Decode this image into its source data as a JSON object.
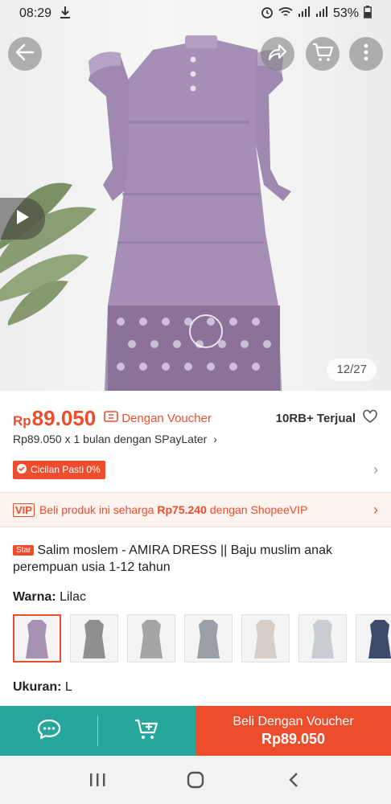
{
  "status_bar": {
    "time": "08:29",
    "battery": "53%",
    "icons": [
      "download-icon",
      "alarm-icon",
      "wifi-icon",
      "signal-icon",
      "signal-icon",
      "battery-icon"
    ]
  },
  "gallery": {
    "counter": "12/27",
    "buttons": [
      "back-arrow-icon",
      "share-icon",
      "cart-icon",
      "more-vertical-icon",
      "play-icon"
    ]
  },
  "price": {
    "currency": "Rp",
    "amount": "89.050",
    "voucher_label": "Dengan Voucher",
    "sold": "10RB+ Terjual"
  },
  "paylater": {
    "text": "Rp89.050 x 1 bulan dengan SPayLater"
  },
  "cicilan": {
    "label": "Cicilan Pasti 0%"
  },
  "vip": {
    "badge": "VIP",
    "text_before": "Beli produk ini seharga",
    "price": "Rp75.240",
    "text_after": "dengan ShopeeVIP"
  },
  "product": {
    "star_badge": "Star",
    "title": "Salim moslem - AMIRA DRESS || Baju muslim anak perempuan usia 1-12 tahun"
  },
  "variant": {
    "warna_label": "Warna:",
    "warna_value": "Lilac",
    "ukuran_label": "Ukuran:",
    "ukuran_value": "L",
    "thumb_colors": [
      "#a892b4",
      "#8f8f8f",
      "#a5a5a5",
      "#9aa0a5",
      "#d6cfc8",
      "#c9ccd2",
      "#3e4a6a"
    ]
  },
  "actions": {
    "buy_label": "Beli Dengan Voucher",
    "buy_price": "Rp89.050"
  },
  "colors": {
    "accent": "#ee4d2d",
    "teal": "#27a79c",
    "dress": "#a58fb5"
  }
}
